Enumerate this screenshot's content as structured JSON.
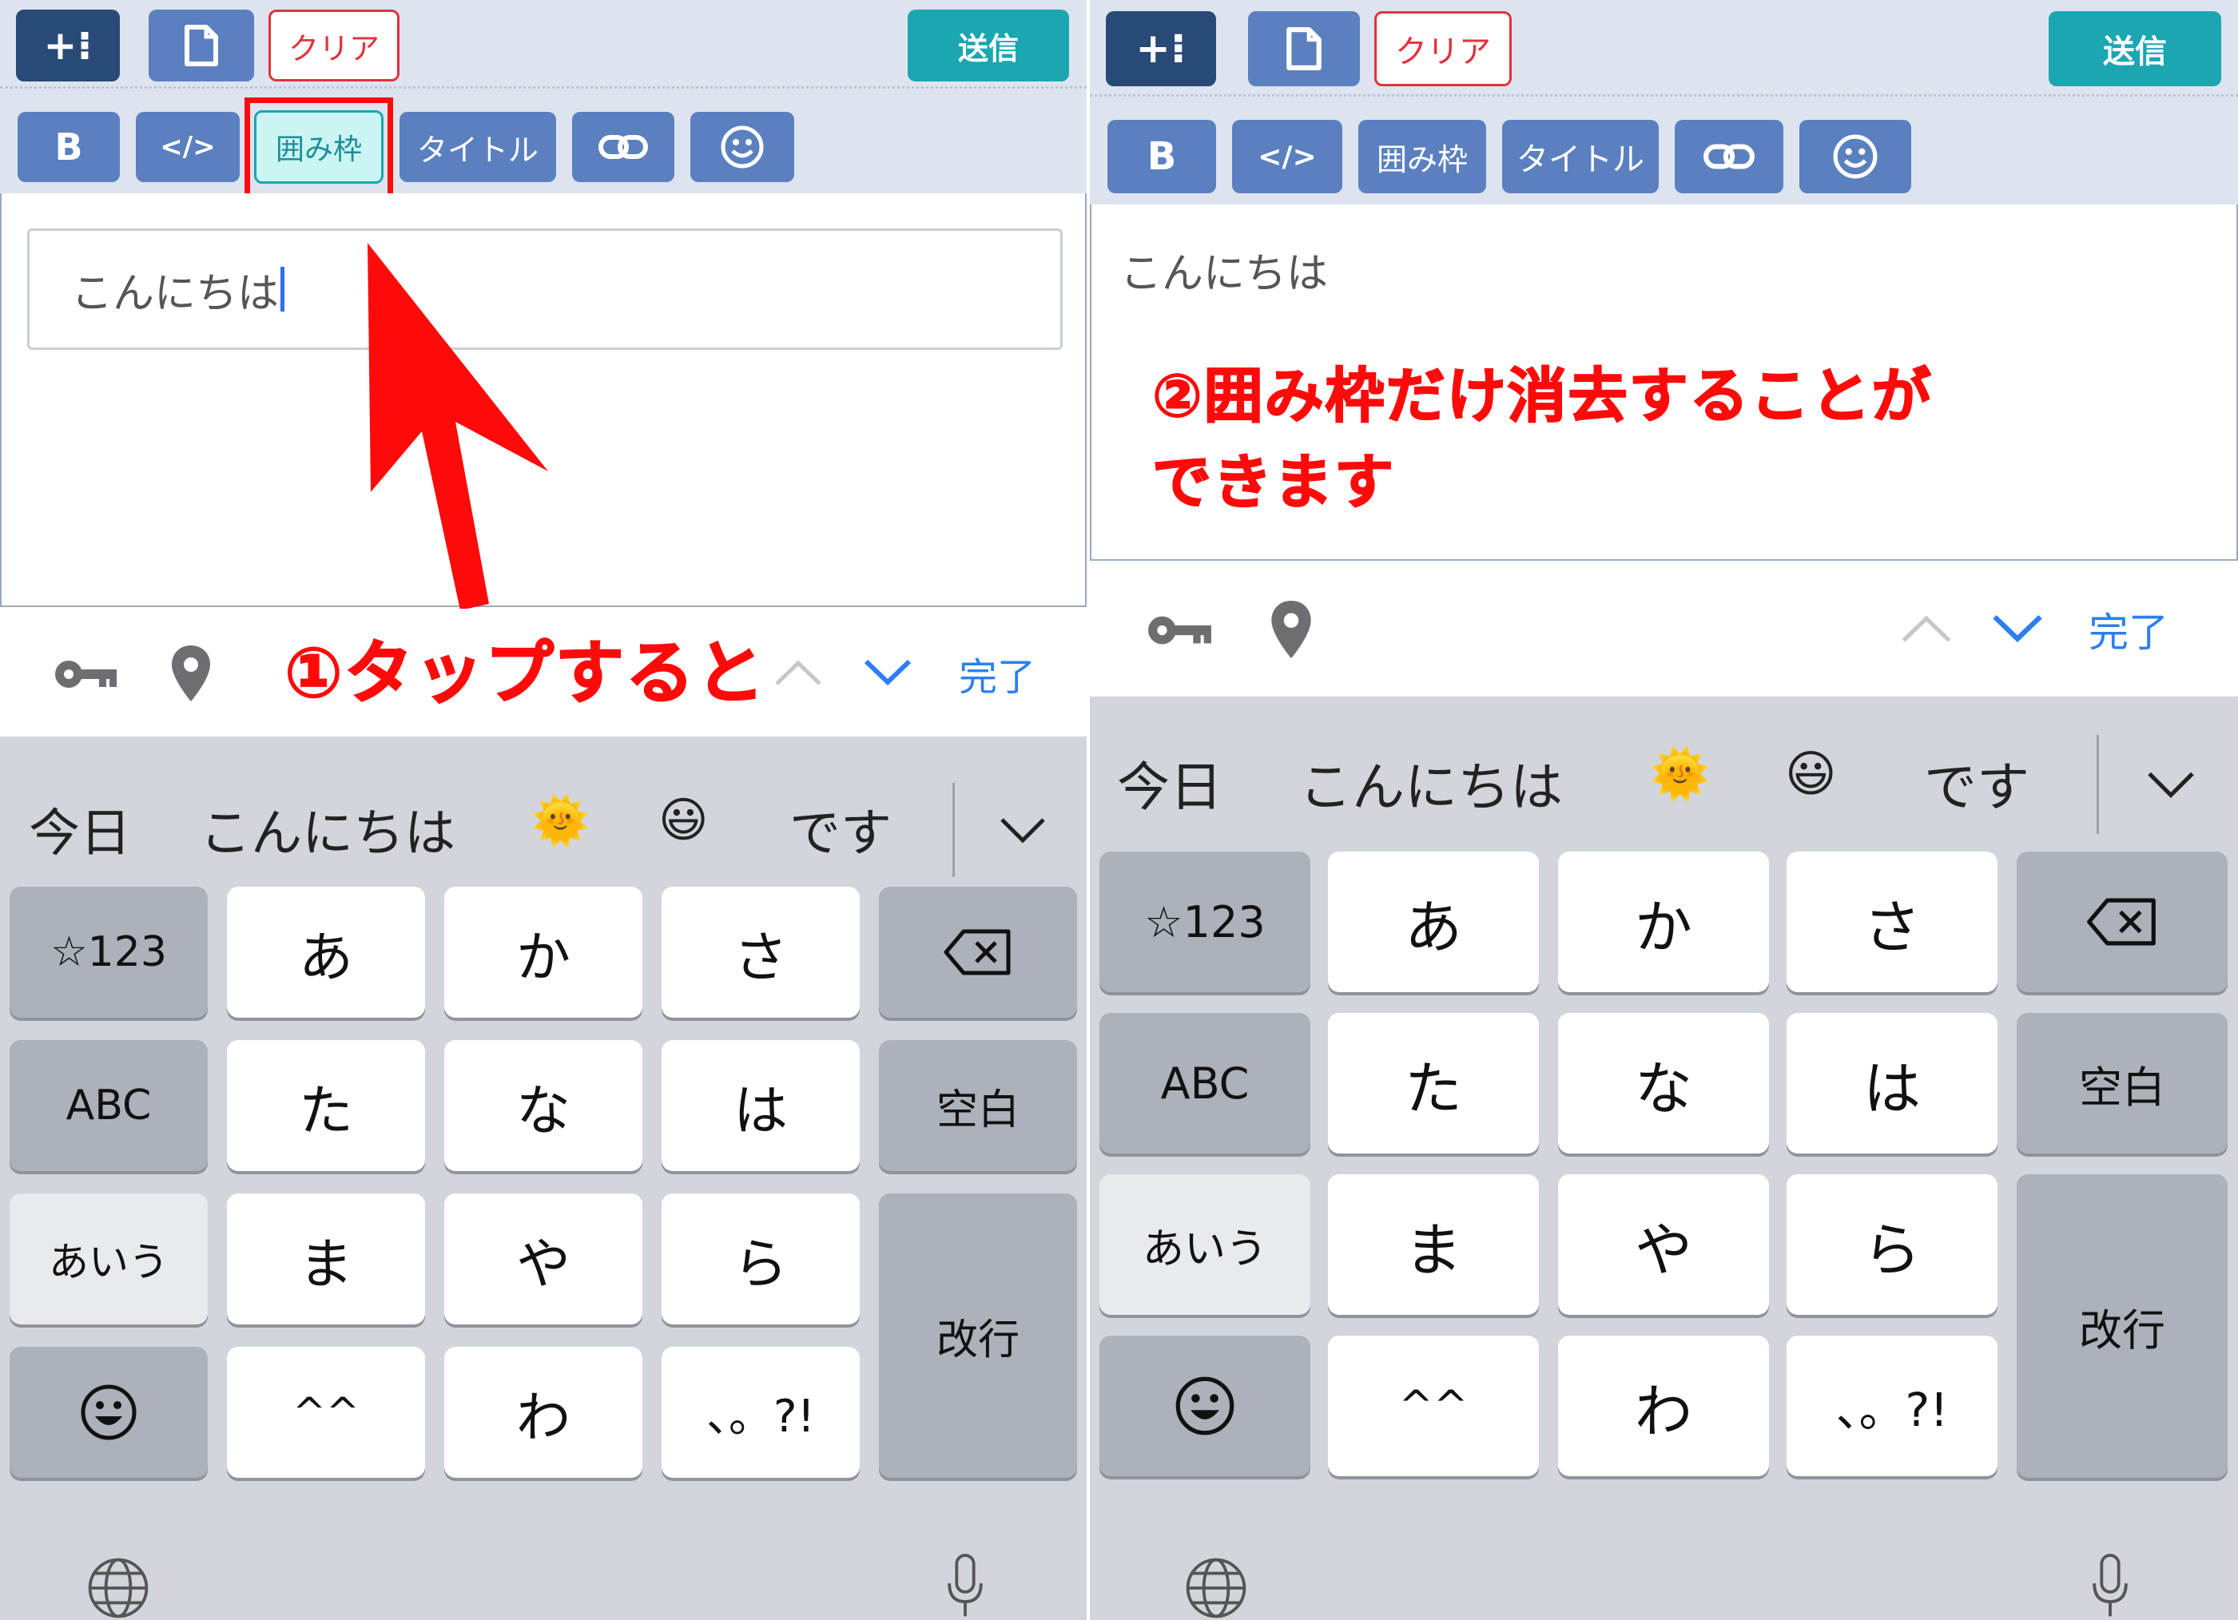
{
  "toolbar": {
    "insert_icon_text": "+⁝",
    "clear_label": "クリア",
    "send_label": "送信",
    "bold_label": "B",
    "code_label": "</>",
    "box_label": "囲み枠",
    "title_label": "タイトル",
    "link_icon_text": "🔗",
    "emoji_icon_text": "☺"
  },
  "left": {
    "editor_text": "こんにちは",
    "annotation": "①タップすると"
  },
  "right": {
    "editor_text": "こんにちは",
    "annotation_line1": "②囲み枠だけ消去することが",
    "annotation_line2": "できます"
  },
  "accessory": {
    "key_icon": "key-icon",
    "location_icon": "location-icon",
    "up_icon": "chevron-up-icon",
    "down_icon": "chevron-down-icon",
    "done_label": "完了"
  },
  "candidates": [
    "今日",
    "こんにちは",
    "🌞",
    "😃",
    "です"
  ],
  "keyboard": {
    "rows": [
      [
        "☆123",
        "あ",
        "か",
        "さ",
        "⌫"
      ],
      [
        "ABC",
        "た",
        "な",
        "は",
        "空白"
      ],
      [
        "あいう",
        "ま",
        "や",
        "ら",
        "改行"
      ],
      [
        "☺",
        "^^",
        "わ",
        "、。?!"
      ]
    ],
    "globe_icon": "globe-icon",
    "mic_icon": "microphone-icon"
  },
  "colors": {
    "toolbar_bg": "#dde4ef",
    "dark_button": "#294a76",
    "blue_button": "#5b80c0",
    "send_button": "#1ba6b1",
    "clear_red": "#e2323d",
    "annotation_red": "#ff0a0a",
    "keyboard_bg": "#d2d5db",
    "done_blue": "#2d7ff0"
  }
}
